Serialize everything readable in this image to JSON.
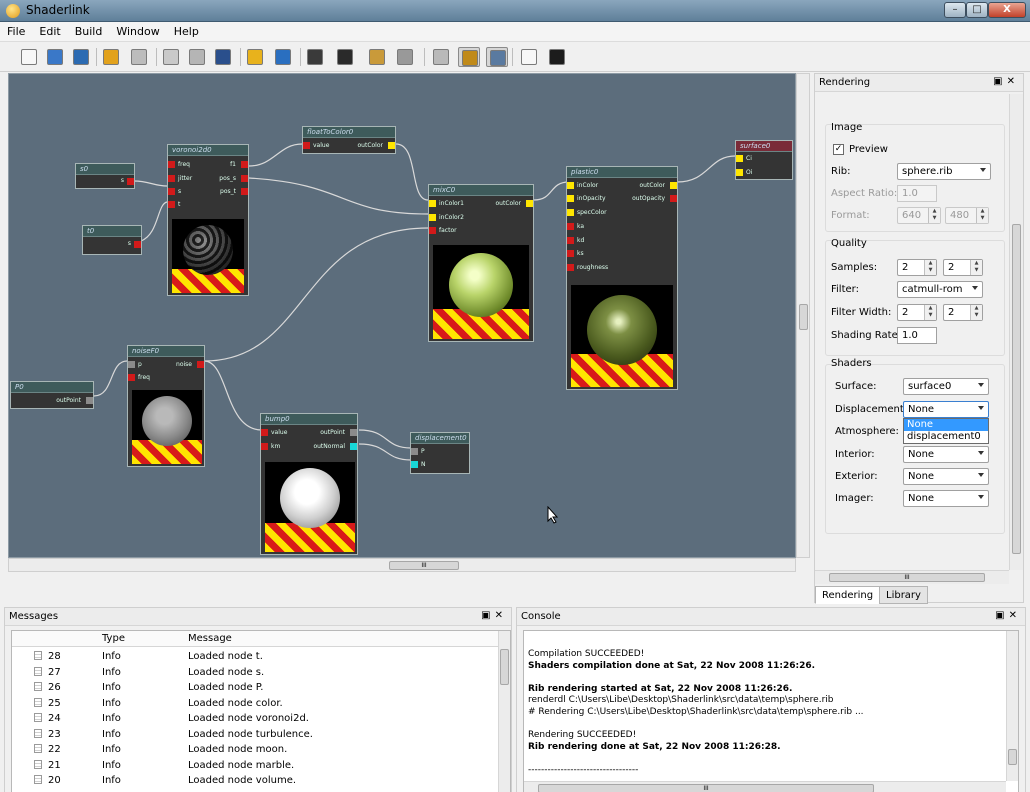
{
  "window": {
    "title": "Shaderlink",
    "min_label": "–",
    "max_label": "□",
    "close_label": "X"
  },
  "menu": [
    "File",
    "Edit",
    "Build",
    "Window",
    "Help"
  ],
  "toolbar_icons": [
    {
      "name": "new-file-icon",
      "color": "#f7f7f7"
    },
    {
      "name": "open-folder-icon",
      "color": "#3a78c8"
    },
    {
      "name": "save-icon",
      "color": "#2c6bb2"
    },
    {
      "name": "undo-icon",
      "color": "#e2a21c"
    },
    {
      "name": "redo-icon",
      "color": "#bcbcbc"
    },
    {
      "name": "copy-icon",
      "color": "#c9c9c9"
    },
    {
      "name": "paste-icon",
      "color": "#b5b5b5"
    },
    {
      "name": "render-settings-icon",
      "color": "#2a4f8c"
    },
    {
      "name": "clean-broom-icon",
      "color": "#e8b21c"
    },
    {
      "name": "globe-icon",
      "color": "#2a6fc0"
    },
    {
      "name": "fit-view-icon",
      "color": "#3a3a3a"
    },
    {
      "name": "clapperboard-icon",
      "color": "#2a2a2a"
    },
    {
      "name": "edit-note-icon",
      "color": "#c99a3a"
    },
    {
      "name": "zoom-icon",
      "color": "#999999"
    },
    {
      "name": "view-mode-a-icon",
      "color": "#b9b9b9"
    },
    {
      "name": "view-mode-b-icon",
      "color": "#c08a1a"
    },
    {
      "name": "view-mode-c-icon",
      "color": "#5a7aa0"
    },
    {
      "name": "list-view-icon",
      "color": "#f7f7f7"
    },
    {
      "name": "terminal-icon",
      "color": "#1c1c1c"
    }
  ],
  "nodes": {
    "s0": {
      "title": "s0",
      "outputs": [
        "s"
      ]
    },
    "t0": {
      "title": "t0",
      "outputs": [
        "s"
      ]
    },
    "voronoi": {
      "title": "voronoi2d0",
      "inputs": [
        "freq",
        "jitter",
        "s",
        "t"
      ],
      "outputs": [
        "f1",
        "pos_s",
        "pos_t"
      ]
    },
    "float2color": {
      "title": "floatToColor0",
      "inputs": [
        "value"
      ],
      "outputs": [
        "outColor"
      ]
    },
    "mix": {
      "title": "mixC0",
      "inputs": [
        "inColor1",
        "inColor2",
        "factor"
      ],
      "outputs": [
        "outColor"
      ]
    },
    "plastic": {
      "title": "plastic0",
      "inputs": [
        "inColor",
        "inOpacity",
        "specColor",
        "ka",
        "kd",
        "ks",
        "roughness"
      ],
      "outputs": [
        "outColor",
        "outOpacity"
      ]
    },
    "surface": {
      "title": "surface0",
      "inputs": [
        "Ci",
        "Oi"
      ]
    },
    "P0": {
      "title": "P0",
      "outputs": [
        "outPoint"
      ]
    },
    "noise": {
      "title": "noiseF0",
      "inputs": [
        "p",
        "freq"
      ],
      "outputs": [
        "noise"
      ]
    },
    "bump": {
      "title": "bump0",
      "inputs": [
        "value",
        "km"
      ],
      "outputs": [
        "outPoint",
        "outNormal"
      ]
    },
    "displacement": {
      "title": "displacement0",
      "inputs": [
        "P",
        "N"
      ]
    }
  },
  "rendering": {
    "dock_title": "Rendering",
    "image_group": "Image",
    "preview_label": "Preview",
    "preview_checked": true,
    "rib_label": "Rib:",
    "rib_value": "sphere.rib",
    "aspect_label": "Aspect Ratio:",
    "aspect_value": "1.0",
    "format_label": "Format:",
    "format_w": "640",
    "format_h": "480",
    "quality_group": "Quality",
    "samples_label": "Samples:",
    "samples_x": "2",
    "samples_y": "2",
    "filter_label": "Filter:",
    "filter_value": "catmull-rom",
    "filterwidth_label": "Filter Width:",
    "filterwidth_x": "2",
    "filterwidth_y": "2",
    "shadingrate_label": "Shading Rate:",
    "shadingrate_value": "1.0",
    "shaders_group": "Shaders",
    "surface_label": "Surface:",
    "surface_value": "surface0",
    "displacement_label": "Displacement:",
    "displacement_value": "None",
    "displacement_options": [
      "None",
      "displacement0"
    ],
    "atmosphere_label": "Atmosphere:",
    "interior_label": "Interior:",
    "interior_value": "None",
    "exterior_label": "Exterior:",
    "exterior_value": "None",
    "imager_label": "Imager:",
    "imager_value": "None",
    "tabs": [
      "Rendering",
      "Library"
    ]
  },
  "messages": {
    "dock_title": "Messages",
    "columns": [
      "Type",
      "Message"
    ],
    "rows": [
      {
        "id": "28",
        "type": "Info",
        "message": "Loaded node t."
      },
      {
        "id": "27",
        "type": "Info",
        "message": "Loaded node s."
      },
      {
        "id": "26",
        "type": "Info",
        "message": "Loaded node P."
      },
      {
        "id": "25",
        "type": "Info",
        "message": "Loaded node color."
      },
      {
        "id": "24",
        "type": "Info",
        "message": "Loaded node voronoi2d."
      },
      {
        "id": "23",
        "type": "Info",
        "message": "Loaded node turbulence."
      },
      {
        "id": "22",
        "type": "Info",
        "message": "Loaded node moon."
      },
      {
        "id": "21",
        "type": "Info",
        "message": "Loaded node marble."
      },
      {
        "id": "20",
        "type": "Info",
        "message": "Loaded node volume."
      }
    ]
  },
  "console": {
    "dock_title": "Console",
    "lines": [
      {
        "text": "Compilation SUCCEEDED!",
        "bold": false
      },
      {
        "text": "Shaders compilation done at Sat, 22 Nov 2008 11:26:26.",
        "bold": true
      },
      {
        "text": "",
        "bold": false
      },
      {
        "text": "Rib rendering started at Sat, 22 Nov 2008 11:26:26.",
        "bold": true
      },
      {
        "text": "renderdl C:\\Users\\Libe\\Desktop\\Shaderlink\\src\\data\\temp\\sphere.rib",
        "bold": false
      },
      {
        "text": "# Rendering C:\\Users\\Libe\\Desktop\\Shaderlink\\src\\data\\temp\\sphere.rib ...",
        "bold": false
      },
      {
        "text": "",
        "bold": false
      },
      {
        "text": "Rendering SUCCEEDED!",
        "bold": false
      },
      {
        "text": "Rib rendering done at Sat, 22 Nov 2008 11:26:28.",
        "bold": true
      },
      {
        "text": "",
        "bold": false
      },
      {
        "text": "----------------------------------",
        "bold": false
      }
    ]
  },
  "dock_buttons": {
    "float": "▣",
    "close": "✕"
  },
  "scroll_grip": "III"
}
